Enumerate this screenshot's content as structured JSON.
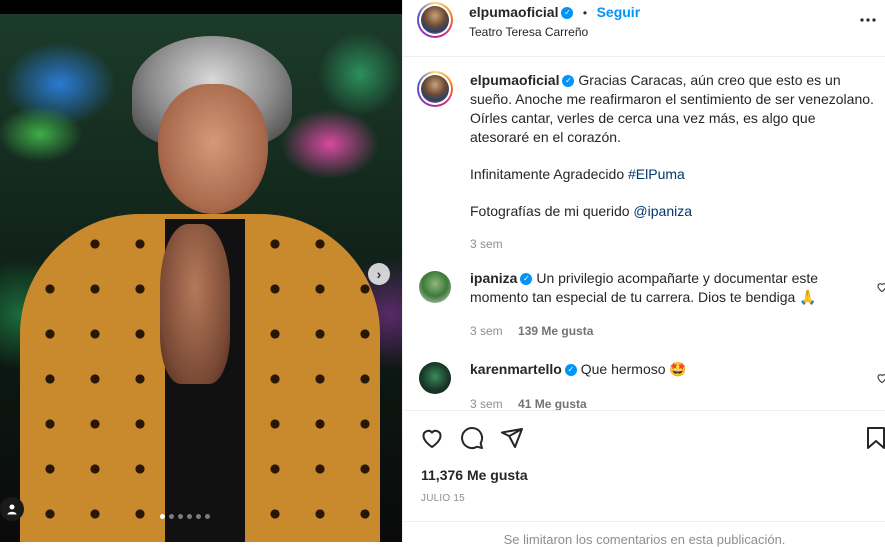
{
  "post": {
    "username": "elpumaoficial",
    "follow_label": "Seguir",
    "separator": "•",
    "location": "Teatro Teresa Carreño",
    "more_label": "•••"
  },
  "caption": {
    "username": "elpumaoficial",
    "text_1": "Gracias Caracas, aún creo que esto es un sueño. Anoche me reafirmaron el sentimiento de ser venezolano. Oírles cantar, verles de cerca una vez más, es algo que atesoraré en el corazón.",
    "text_2_prefix": "Infinitamente Agradecido ",
    "hashtag": "#ElPuma",
    "text_3_prefix": "Fotografías de mi querido ",
    "mention": "@ipaniza",
    "time": "3 sem"
  },
  "comments": [
    {
      "username": "ipaniza",
      "text": "Un privilegio acompañarte y documentar este momento tan especial de tu carrera. Dios te bendiga 🙏",
      "time": "3 sem",
      "likes": "139 Me gusta"
    },
    {
      "username": "karenmartello",
      "text": "Que hermoso 🤩",
      "time": "3 sem",
      "likes": "41 Me gusta"
    }
  ],
  "engagement": {
    "likes": "11,376 Me gusta",
    "date": "JULIO 15",
    "comments_disabled": "Se limitaron los comentarios en esta publicación."
  },
  "carousel": {
    "next_label": "›",
    "total_slides": 6,
    "active_slide": 1
  },
  "colors": {
    "accent": "#0095f6",
    "link": "#00376b",
    "muted": "#8e8e8e"
  }
}
